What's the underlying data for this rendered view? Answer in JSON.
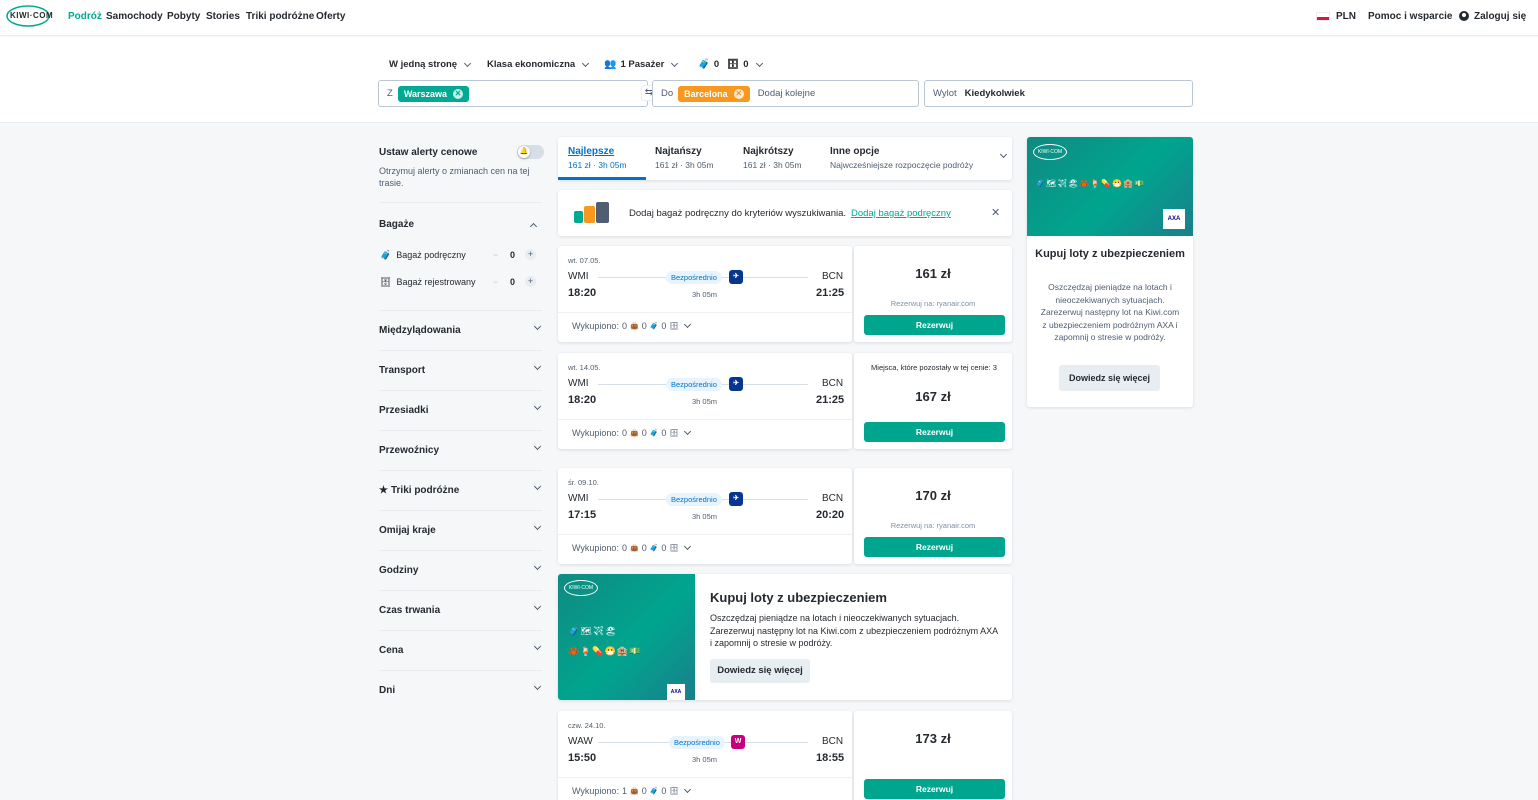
{
  "nav": {
    "logo": "KIWI·COM",
    "links": [
      "Podróż",
      "Samochody",
      "Pobyty",
      "Stories",
      "Triki podróżne",
      "Oferty"
    ],
    "currency": "PLN",
    "help": "Pomoc i wsparcie",
    "login": "Zaloguj się"
  },
  "search": {
    "trip_type": "W jedną stronę",
    "cabin": "Klasa ekonomiczna",
    "passengers": "1 Pasażer",
    "cabin_bags": "0",
    "checked_bags": "0",
    "from_label": "Z",
    "from_value": "Warszawa",
    "to_label": "Do",
    "to_value": "Barcelona",
    "to_placeholder": "Dodaj kolejne",
    "depart_label": "Wylot",
    "depart_value": "Kiedykolwiek"
  },
  "sidebar": {
    "alerts_title": "Ustaw alerty cenowe",
    "alerts_desc": "Otrzymuj alerty o zmianach cen na tej trasie.",
    "bags_title": "Bagaże",
    "cabin_bag": "Bagaż podręczny",
    "cabin_bag_count": "0",
    "checked_bag": "Bagaż rejestrowany",
    "checked_bag_count": "0",
    "filters": [
      "Międzylądowania",
      "Transport",
      "Przesiadki",
      "Przewoźnicy",
      "Triki podróżne",
      "Omijaj kraje",
      "Godziny",
      "Czas trwania",
      "Cena",
      "Dni"
    ]
  },
  "tabs": [
    {
      "label": "Najlepsze",
      "sub": "161 zł · 3h 05m"
    },
    {
      "label": "Najtańszy",
      "sub": "161 zł · 3h 05m"
    },
    {
      "label": "Najkrótszy",
      "sub": "161 zł · 3h 05m"
    },
    {
      "label": "Inne opcje",
      "sub": "Najwcześniejsze rozpoczęcie podróży"
    }
  ],
  "bag_banner": {
    "text": "Dodaj bagaż podręczny do kryteriów wyszukiwania.",
    "link": "Dodaj bagaż podręczny"
  },
  "flights": [
    {
      "date": "wt. 07.05.",
      "from": "WMI",
      "to": "BCN",
      "dep": "18:20",
      "arr": "21:25",
      "type": "Bezpośrednio",
      "duration": "3h 05m",
      "carrier": "ryanair",
      "bags_label": "Wykupiono:",
      "bag1": "0",
      "bag2": "0",
      "bag3": "0",
      "price": "161 zł",
      "book_via": "Rezerwuj na: ryanair.com",
      "book": "Rezerwuj",
      "seats_note": ""
    },
    {
      "date": "wt. 14.05.",
      "from": "WMI",
      "to": "BCN",
      "dep": "18:20",
      "arr": "21:25",
      "type": "Bezpośrednio",
      "duration": "3h 05m",
      "carrier": "ryanair",
      "bags_label": "Wykupiono:",
      "bag1": "0",
      "bag2": "0",
      "bag3": "0",
      "price": "167 zł",
      "book_via": "Rezerwuj na: ryanair.com",
      "book": "Rezerwuj",
      "seats_note": "Miejsca, które pozostały w tej cenie: 3"
    },
    {
      "date": "śr. 09.10.",
      "from": "WMI",
      "to": "BCN",
      "dep": "17:15",
      "arr": "20:20",
      "type": "Bezpośrednio",
      "duration": "3h 05m",
      "carrier": "ryanair",
      "bags_label": "Wykupiono:",
      "bag1": "0",
      "bag2": "0",
      "bag3": "0",
      "price": "170 zł",
      "book_via": "Rezerwuj na: ryanair.com",
      "book": "Rezerwuj",
      "seats_note": ""
    },
    {
      "date": "czw. 24.10.",
      "from": "WAW",
      "to": "BCN",
      "dep": "15:50",
      "arr": "18:55",
      "type": "Bezpośrednio",
      "duration": "3h 05m",
      "carrier": "wizz",
      "bags_label": "Wykupiono:",
      "bag1": "1",
      "bag2": "0",
      "bag3": "0",
      "price": "173 zł",
      "book_via": "",
      "book": "Rezerwuj",
      "seats_note": ""
    }
  ],
  "promo": {
    "title": "Kupuj loty z ubezpieczeniem",
    "desc": "Oszczędzaj pieniądze na lotach i nieoczekiwanych sytuacjach. Zarezerwuj następny lot na Kiwi.com z ubezpieczeniem podróżnym AXA i zapomnij o stresie w podróży.",
    "cta": "Dowiedz się więcej",
    "brand": "AXA",
    "logo": "KIWI·COM"
  },
  "side_promo": {
    "title": "Kupuj loty z ubezpieczeniem",
    "desc": "Oszczędzaj pieniądze na lotach i nieoczekiwanych sytuacjach. Zarezerwuj następny lot na Kiwi.com z ubezpieczeniem podróżnym AXA i zapomnij o stresie w podróży.",
    "cta": "Dowiedz się więcej"
  },
  "colors": {
    "accent": "#00a991",
    "button": "#00a58e",
    "from_chip": "#00a991",
    "to_chip": "#f9971e",
    "ryanair": "#073590",
    "wizz": "#c6007e"
  }
}
